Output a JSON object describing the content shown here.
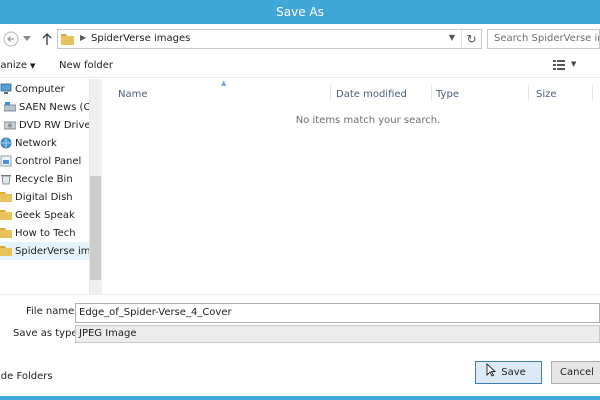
{
  "window": {
    "title": "Save As"
  },
  "address": {
    "path": "SpiderVerse images",
    "search_placeholder": "Search SpiderVerse im..."
  },
  "toolbar": {
    "organize_label": "ganize",
    "new_folder_label": "New folder"
  },
  "nav": {
    "items": [
      {
        "label": "Computer",
        "icon": "computer-icon"
      },
      {
        "label": "SAEN News (C:)",
        "icon": "drive-icon"
      },
      {
        "label": "DVD RW Drive (",
        "icon": "dvd-drive-icon"
      },
      {
        "label": "Network",
        "icon": "network-icon"
      },
      {
        "label": "Control Panel",
        "icon": "control-panel-icon"
      },
      {
        "label": "Recycle Bin",
        "icon": "recycle-bin-icon"
      },
      {
        "label": "Digital Dish",
        "icon": "folder-icon"
      },
      {
        "label": "Geek Speak",
        "icon": "folder-icon"
      },
      {
        "label": "How to Tech",
        "icon": "folder-icon"
      },
      {
        "label": "SpiderVerse imag",
        "icon": "folder-icon",
        "selected": true
      }
    ]
  },
  "file_list": {
    "columns": [
      "Name",
      "Date modified",
      "Type",
      "Size"
    ],
    "empty_message": "No items match your search."
  },
  "form": {
    "file_name_label": "File name:",
    "file_name_value": "Edge_of_Spider-Verse_4_Cover",
    "save_as_type_label": "Save as type:",
    "save_as_type_value": "JPEG Image"
  },
  "footer": {
    "hide_folders_label": "ide Folders",
    "save_label": "Save",
    "cancel_label": "Cancel"
  },
  "colors": {
    "title_bar": "#41a7d9",
    "folder": "#e8c25a",
    "selection": "#e5f3fb",
    "save_button_border": "#3c7fb1"
  }
}
